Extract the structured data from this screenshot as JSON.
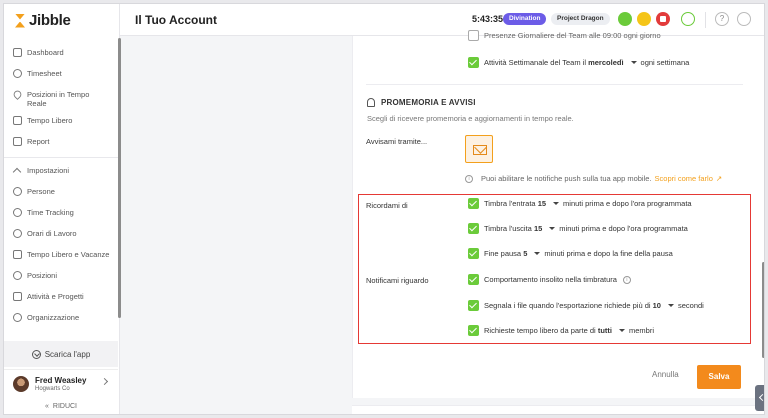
{
  "app": {
    "logo_text": "Jibble",
    "page_title": "Il Tuo Account"
  },
  "topbar": {
    "timer": "5:43:35",
    "project": "Divination",
    "activity": "Project Dragon",
    "help": "?"
  },
  "sidebar": {
    "items": [
      {
        "label": "Dashboard"
      },
      {
        "label": "Timesheet"
      },
      {
        "label": "Posizioni in Tempo Reale"
      },
      {
        "label": "Tempo Libero"
      },
      {
        "label": "Report"
      }
    ],
    "settings_header": "Impostazioni",
    "settings_items": [
      {
        "label": "Persone"
      },
      {
        "label": "Time Tracking"
      },
      {
        "label": "Orari di Lavoro"
      },
      {
        "label": "Tempo Libero e Vacanze"
      },
      {
        "label": "Posizioni"
      },
      {
        "label": "Attività e Progetti"
      },
      {
        "label": "Organizzazione"
      }
    ],
    "download": "Scarica l'app",
    "user": {
      "name": "Fred Weasley",
      "org": "Hogwarts Co"
    },
    "collapse": "RIDUCI"
  },
  "weekly": {
    "partial_label": "Presenze Giornaliere del Team alle 09:00 ogni giorno",
    "prefix": "Attività Settimanale del Team il",
    "day": "mercoledì",
    "suffix": "ogni settimana"
  },
  "reminders": {
    "title": "PROMEMORIA E AVVISI",
    "subtitle": "Scegli di ricevere promemoria e aggiornamenti in tempo reale.",
    "notify_via_label": "Avvisami tramite...",
    "push_info": "Puoi abilitare le notifiche push sulla tua app mobile.",
    "push_link": "Scopri come farlo",
    "remind_label": "Ricordami di",
    "clock_in": {
      "prefix": "Timbra l'entrata",
      "value": "15",
      "suffix": "minuti prima e dopo l'ora programmata"
    },
    "clock_out": {
      "prefix": "Timbra l'uscita",
      "value": "15",
      "suffix": "minuti prima e dopo l'ora programmata"
    },
    "break_end": {
      "prefix": "Fine pausa",
      "value": "5",
      "suffix": "minuti prima e dopo la fine della pausa"
    },
    "notify_label": "Notificami riguardo",
    "unusual": "Comportamento insolito nella timbratura",
    "export": {
      "prefix": "Segnala i file quando l'esportazione richiede più di",
      "value": "10",
      "suffix": "secondi"
    },
    "timeoff": {
      "prefix": "Richieste tempo libero da parte di",
      "value": "tutti",
      "suffix": "membri"
    }
  },
  "actions": {
    "cancel": "Annulla",
    "save": "Salva"
  },
  "colors": {
    "accent": "#f38a1c",
    "checkbox": "#6bcb3a",
    "project_pill": "#6c5ce7",
    "highlight_border": "#e53935"
  }
}
